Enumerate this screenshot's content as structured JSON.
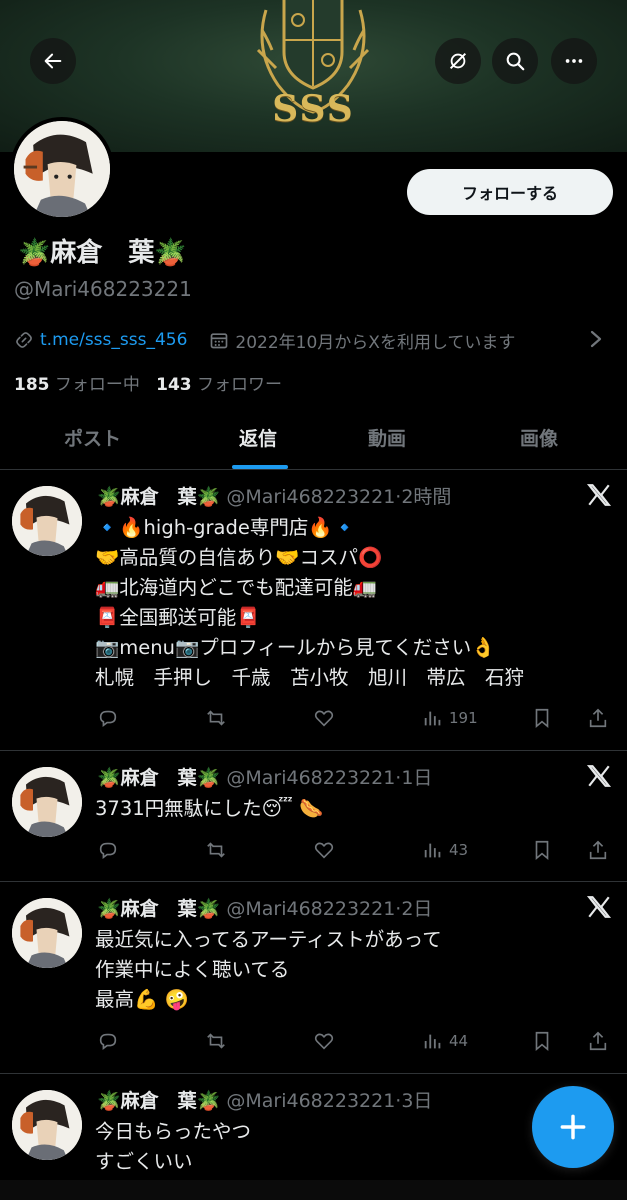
{
  "header": {
    "banner_text": "SSS",
    "back_icon": "arrow-left-icon",
    "grok_icon": "grok-icon",
    "search_icon": "search-icon",
    "more_icon": "more-horizontal-icon"
  },
  "profile": {
    "follow_label": "フォローする",
    "display_name": "🪴麻倉　葉🪴",
    "handle": "@Mari468223221",
    "link": "t.me/sss_sss_456",
    "joined": "2022年10月からXを利用しています",
    "following_count": "185",
    "following_label": "フォロー中",
    "followers_count": "143",
    "followers_label": "フォロワー"
  },
  "tabs": [
    "ポスト",
    "返信",
    "動画",
    "画像"
  ],
  "active_tab": "返信",
  "posts": [
    {
      "name": "🪴麻倉　葉🪴",
      "handle_time": "@Mari468223221·2時間",
      "lines": [
        "🔹🔥high-grade専門店🔥🔹",
        "🤝高品質の自信あり🤝コスパ⭕",
        "🚛北海道内どこでも配達可能🚛",
        "📮全国郵送可能📮",
        "📷menu📷プロフィールから見てください👌",
        "札幌　手押し　千歳　苫小牧　旭川　帯広　石狩"
      ],
      "views": "191"
    },
    {
      "name": "🪴麻倉　葉🪴",
      "handle_time": "@Mari468223221·1日",
      "lines": [
        "3731円無駄にした😴 🌭"
      ],
      "views": "43"
    },
    {
      "name": "🪴麻倉　葉🪴",
      "handle_time": "@Mari468223221·2日",
      "lines": [
        "最近気に入ってるアーティストがあって",
        "作業中によく聴いてる",
        "最高💪 🤪"
      ],
      "views": "44"
    },
    {
      "name": "🪴麻倉　葉🪴",
      "handle_time": "@Mari468223221·3日",
      "lines": [
        "今日もらったやつ",
        "すごくいい"
      ]
    }
  ],
  "colors": {
    "accent": "#1d9bf0",
    "background": "#000000",
    "secondary_text": "#71767b",
    "banner_gold": "#d8b85a"
  }
}
